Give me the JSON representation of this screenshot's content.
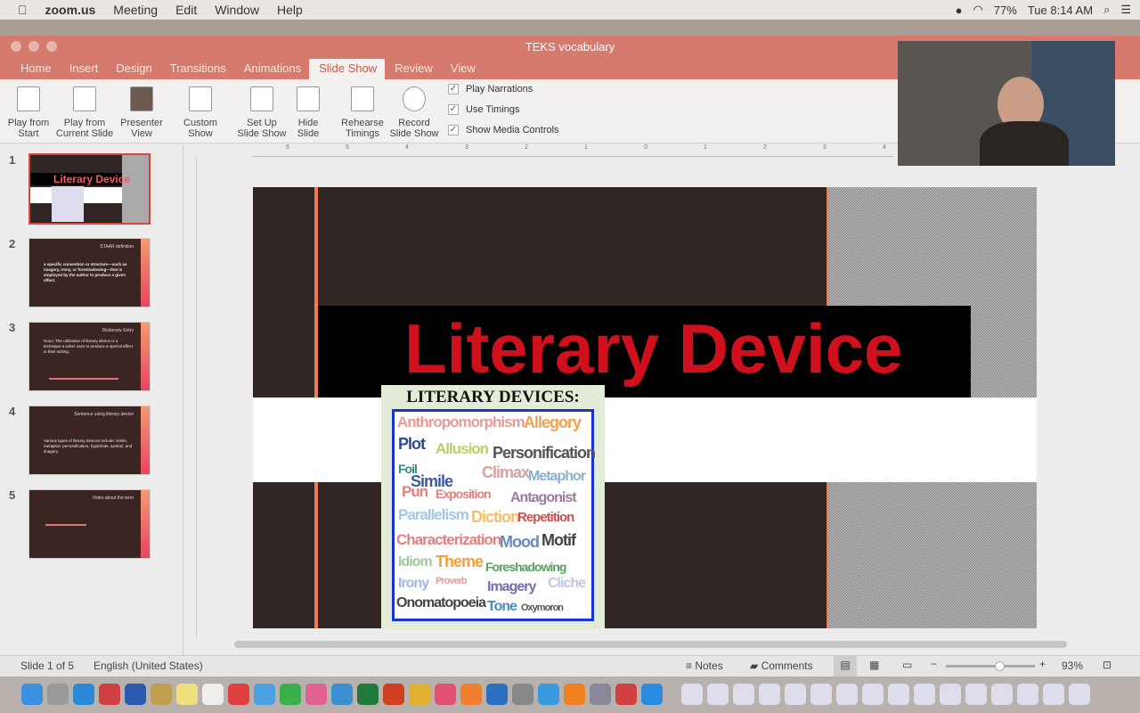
{
  "menubar": {
    "app": "zoom.us",
    "items": [
      "Meeting",
      "Edit",
      "Window",
      "Help"
    ],
    "battery": "77%",
    "clock": "Tue 8:14 AM"
  },
  "window": {
    "title": "TEKS vocabulary"
  },
  "tabs": [
    "Home",
    "Insert",
    "Design",
    "Transitions",
    "Animations",
    "Slide Show",
    "Review",
    "View"
  ],
  "active_tab": "Slide Show",
  "ribbon": {
    "buttons": [
      "Play from Start",
      "Play from Current Slide",
      "Presenter View",
      "Custom Show",
      "Set Up Slide Show",
      "Hide Slide",
      "Rehearse Timings",
      "Record Slide Show"
    ],
    "checks": [
      {
        "label": "Play Narrations",
        "checked": true
      },
      {
        "label": "Use Timings",
        "checked": true
      },
      {
        "label": "Show Media Controls",
        "checked": true
      }
    ]
  },
  "thumbnails": [
    {
      "num": "1",
      "title": "Literary Device"
    },
    {
      "num": "2",
      "title": "STAAR definition",
      "body": "a specific convention or structure—such as imagery, irony, or foreshadowing—that is employed by the author to produce a given effect."
    },
    {
      "num": "3",
      "title": "Dictionary Entry",
      "body": "Noun: The utilization of literary device is a technique a writer uses to produce a special effect in their writing."
    },
    {
      "num": "4",
      "title": "Sentence using literary device",
      "body": "Various types of literary devices include: simile, metaphor, personification, hyperbole, symbol, and imagery."
    },
    {
      "num": "5",
      "title": "Video about the term"
    }
  ],
  "slide": {
    "title": "Literary Device",
    "image_title": "LITERARY DEVICES:",
    "words": [
      "Anthropomorphism",
      "Allegory",
      "Plot",
      "Allusion",
      "Personification",
      "Foil",
      "Simile",
      "Climax",
      "Metaphor",
      "Pun",
      "Exposition",
      "Antagonist",
      "Parallelism",
      "Diction",
      "Repetition",
      "Characterization",
      "Mood",
      "Motif",
      "Idiom",
      "Theme",
      "Foreshadowing",
      "Irony",
      "Proverb",
      "Imagery",
      "Cliche",
      "Onomatopoeia",
      "Tone",
      "Oxymoron"
    ]
  },
  "ruler": [
    "6",
    "5",
    "4",
    "3",
    "2",
    "1",
    "0",
    "1",
    "2",
    "3",
    "4"
  ],
  "statusbar": {
    "slide": "Slide 1 of 5",
    "language": "English (United States)",
    "notes": "Notes",
    "comments": "Comments",
    "zoom": "93%",
    "zoom_level": 0.6
  }
}
